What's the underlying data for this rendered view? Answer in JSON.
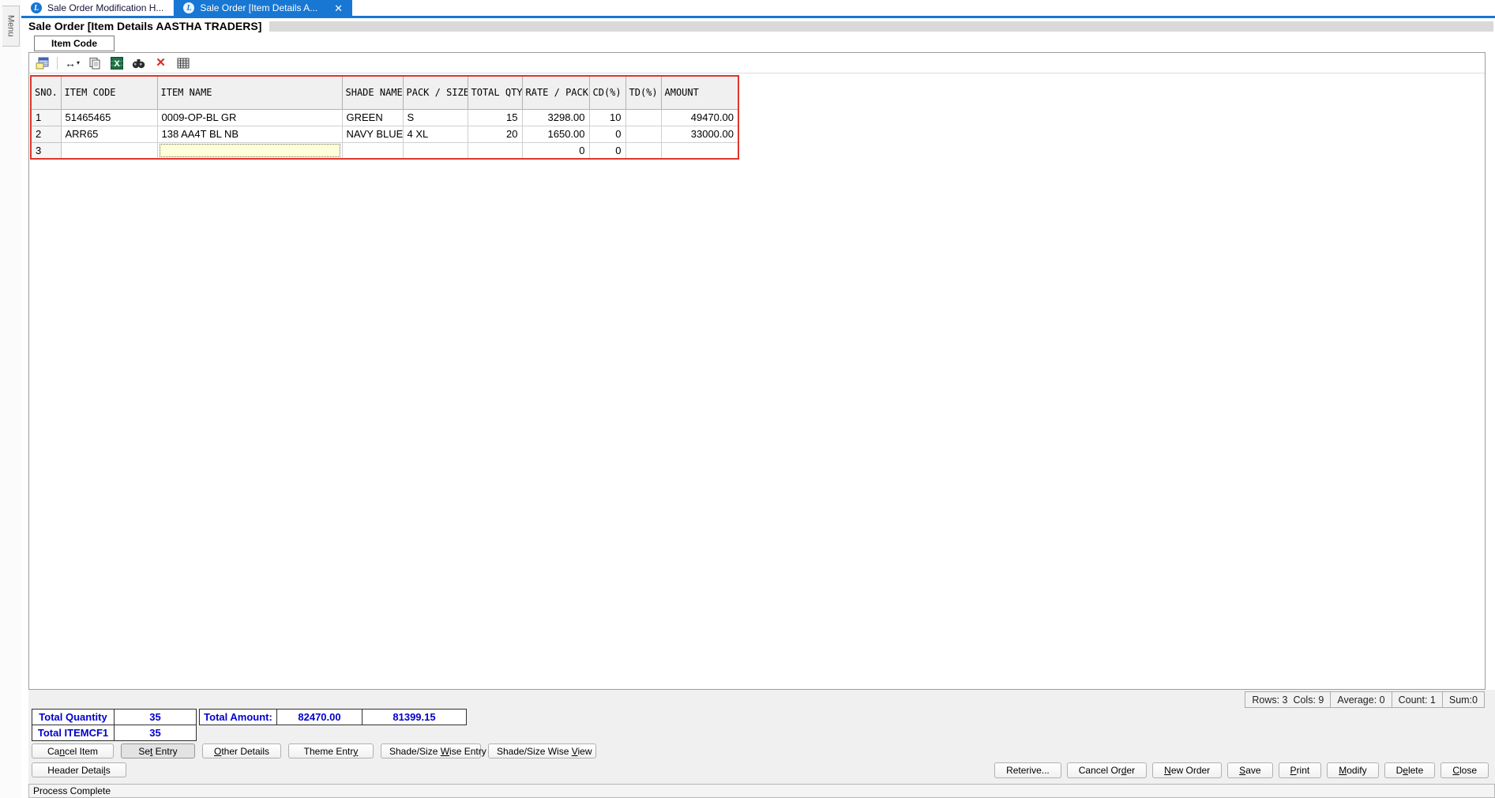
{
  "menu_label": "Menu",
  "tabs": [
    {
      "label": "Sale Order Modification H...",
      "active": false
    },
    {
      "label": "Sale Order [Item Details A...",
      "active": true,
      "close_glyph": "✕"
    }
  ],
  "logo_letter": "L",
  "title": "Sale Order [Item Details AASTHA TRADERS]",
  "item_code_button_label": "Item Code",
  "toolbar_icons": [
    "form-icon",
    "column-width-icon",
    "copy-icon",
    "excel-export-icon",
    "find-icon",
    "delete-row-icon",
    "grid-icon"
  ],
  "grid": {
    "columns": [
      "SNO.",
      "ITEM CODE",
      "ITEM NAME",
      "SHADE NAME",
      "PACK / SIZE",
      "TOTAL QTY",
      "RATE / PACK",
      "CD(%)",
      "TD(%)",
      "AMOUNT"
    ],
    "rows": [
      [
        "1",
        "51465465",
        "0009-OP-BL GR",
        "GREEN",
        "S",
        "15",
        "3298.00",
        "10",
        "",
        "49470.00"
      ],
      [
        "2",
        "ARR65",
        "138 AA4T BL NB",
        "NAVY BLUE",
        "4 XL",
        "20",
        "1650.00",
        "0",
        "",
        "33000.00"
      ],
      [
        "3",
        "",
        "",
        "",
        "",
        "",
        "0",
        "0",
        "",
        ""
      ]
    ],
    "editing_cell": {
      "row": 2,
      "col": 2
    }
  },
  "stats": {
    "rows_cols": "Rows: 3  Cols: 9",
    "average": "Average: 0",
    "count": "Count: 1",
    "sum": "Sum:0"
  },
  "totals": {
    "quantity_label": "Total Quantity",
    "quantity_value": "35",
    "itemcf1_label": "Total ITEMCF1",
    "itemcf1_value": "35",
    "amount_label": "Total Amount:",
    "amount_value1": "82470.00",
    "amount_value2": "81399.15"
  },
  "action_buttons": [
    {
      "name": "cancel-item",
      "pre": "Ca",
      "key": "n",
      "post": "cel Item",
      "pressed": false
    },
    {
      "name": "set-entry",
      "pre": "Se",
      "key": "t",
      "post": " Entry",
      "pressed": true
    },
    {
      "name": "other-details",
      "pre": "",
      "key": "O",
      "post": "ther Details",
      "pressed": false
    },
    {
      "name": "theme-entry",
      "pre": "Theme Entr",
      "key": "y",
      "post": "",
      "pressed": false
    },
    {
      "name": "shade-size-wise-entry",
      "pre": "Shade/Size ",
      "key": "W",
      "post": "ise Entry",
      "pressed": false
    },
    {
      "name": "shade-size-wise-view",
      "pre": "Shade/Size Wise ",
      "key": "V",
      "post": "iew",
      "pressed": false
    }
  ],
  "header_details_button": {
    "pre": "Header Detai",
    "key": "l",
    "post": "s"
  },
  "order_buttons": [
    {
      "name": "reterive",
      "pre": "Reterive...",
      "key": "",
      "post": "",
      "pressed": false
    },
    {
      "name": "cancel-order",
      "pre": "Cancel Or",
      "key": "d",
      "post": "er",
      "pressed": false
    },
    {
      "name": "new-order",
      "pre": "",
      "key": "N",
      "post": "ew Order",
      "pressed": false
    },
    {
      "name": "save",
      "pre": "",
      "key": "S",
      "post": "ave",
      "pressed": false
    },
    {
      "name": "print",
      "pre": "",
      "key": "P",
      "post": "rint",
      "pressed": false
    },
    {
      "name": "modify",
      "pre": "",
      "key": "M",
      "post": "odify",
      "pressed": false
    },
    {
      "name": "delete",
      "pre": "D",
      "key": "e",
      "post": "lete",
      "pressed": false
    },
    {
      "name": "close",
      "pre": "",
      "key": "C",
      "post": "lose",
      "pressed": false
    }
  ],
  "status_bar_text": "Process Complete",
  "colors": {
    "accent_blue": "#1777d3",
    "grid_border_red": "#e0352b",
    "totals_text_blue": "#0000cc"
  }
}
